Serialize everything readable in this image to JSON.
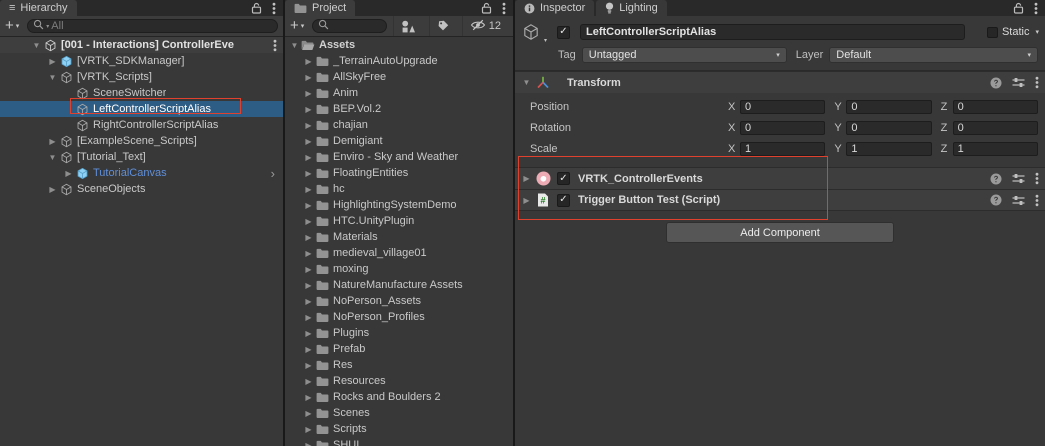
{
  "annotation": {
    "color": "#e0402e"
  },
  "hierarchy": {
    "tab": "Hierarchy",
    "search_placeholder": "All",
    "scene": {
      "label": "[001 - Interactions] ControllerEve"
    },
    "items": [
      {
        "label": "[VRTK_SDKManager]",
        "depth": 1,
        "arrow": "collapsed",
        "icon": "prefab"
      },
      {
        "label": "[VRTK_Scripts]",
        "depth": 1,
        "arrow": "expanded",
        "icon": "gameobject"
      },
      {
        "label": "SceneSwitcher",
        "depth": 2,
        "arrow": "none",
        "icon": "gameobject"
      },
      {
        "label": "LeftControllerScriptAlias",
        "depth": 2,
        "arrow": "none",
        "icon": "gameobject",
        "selected": true
      },
      {
        "label": "RightControllerScriptAlias",
        "depth": 2,
        "arrow": "none",
        "icon": "gameobject"
      },
      {
        "label": "[ExampleScene_Scripts]",
        "depth": 1,
        "arrow": "collapsed",
        "icon": "gameobject"
      },
      {
        "label": "[Tutorial_Text]",
        "depth": 1,
        "arrow": "expanded",
        "icon": "gameobject"
      },
      {
        "label": "TutorialCanvas",
        "depth": 2,
        "arrow": "collapsed",
        "icon": "prefab",
        "prefab_text": true,
        "chevron": true
      },
      {
        "label": "SceneObjects",
        "depth": 1,
        "arrow": "collapsed",
        "icon": "gameobject"
      }
    ]
  },
  "project": {
    "tab": "Project",
    "search_placeholder": "",
    "hidden_count": "12",
    "root_label": "Assets",
    "folders": [
      "_TerrainAutoUpgrade",
      "AllSkyFree",
      "Anim",
      "BEP.Vol.2",
      "chajian",
      "Demigiant",
      "Enviro - Sky and Weather",
      "FloatingEntities",
      "hc",
      "HighlightingSystemDemo",
      "HTC.UnityPlugin",
      "Materials",
      "medieval_village01",
      "moxing",
      "NatureManufacture Assets",
      "NoPerson_Assets",
      "NoPerson_Profiles",
      "Plugins",
      "Prefab",
      "Res",
      "Resources",
      "Rocks and Boulders 2",
      "Scenes",
      "Scripts",
      "SHUI"
    ]
  },
  "inspector": {
    "tab": "Inspector",
    "lighting_tab": "Lighting",
    "name_value": "LeftControllerScriptAlias",
    "static_label": "Static",
    "tag_label": "Tag",
    "tag_value": "Untagged",
    "layer_label": "Layer",
    "layer_value": "Default",
    "transform": {
      "title": "Transform",
      "axis_labels": [
        "X",
        "Y",
        "Z"
      ],
      "rows": [
        {
          "label": "Position",
          "x": "0",
          "y": "0",
          "z": "0"
        },
        {
          "label": "Rotation",
          "x": "0",
          "y": "0",
          "z": "0"
        },
        {
          "label": "Scale",
          "x": "1",
          "y": "1",
          "z": "1"
        }
      ]
    },
    "components": [
      {
        "label": "VRTK_ControllerEvents",
        "icon": "vrtk",
        "enabled": true
      },
      {
        "label": "Trigger Button Test (Script)",
        "icon": "script",
        "enabled": true
      }
    ],
    "add_component_label": "Add Component"
  }
}
